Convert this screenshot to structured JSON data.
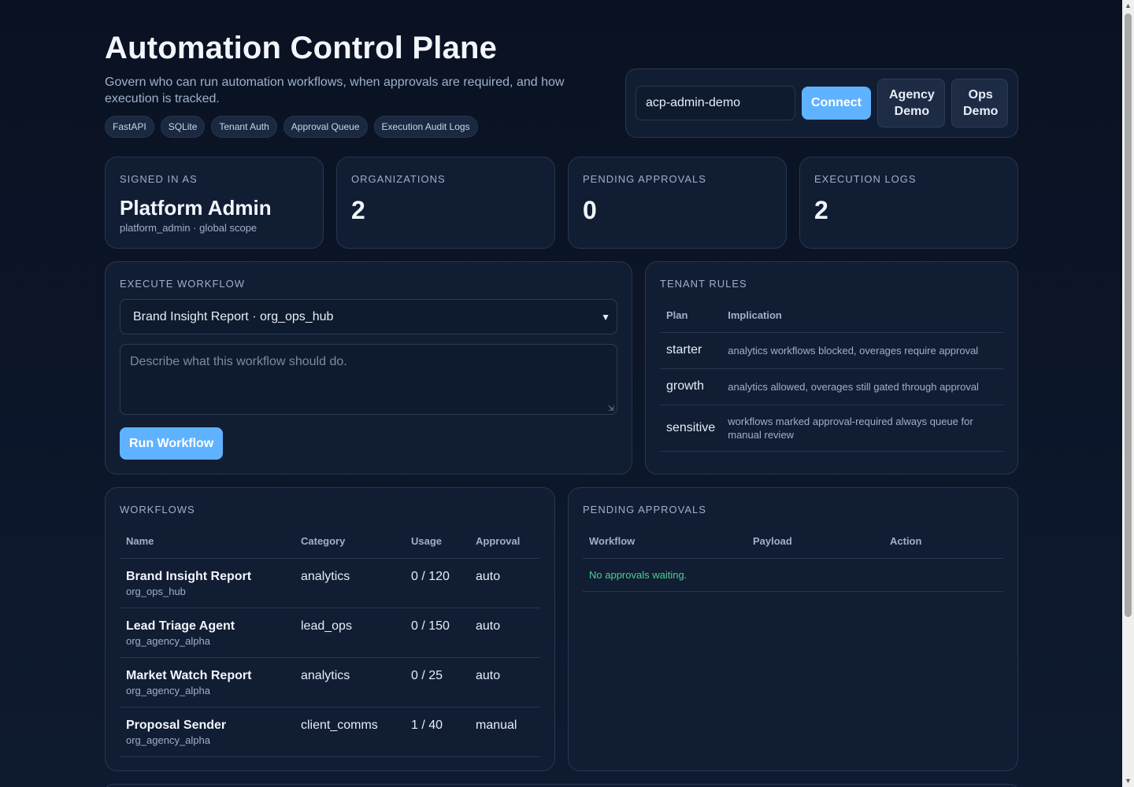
{
  "header": {
    "title": "Automation Control Plane",
    "subtitle": "Govern who can run automation workflows, when approvals are required, and how execution is tracked.",
    "tags": [
      "FastAPI",
      "SQLite",
      "Tenant Auth",
      "Approval Queue",
      "Execution Audit Logs"
    ]
  },
  "connect": {
    "token_value": "acp-admin-demo",
    "connect_label": "Connect",
    "agency_demo_label": "Agency Demo",
    "ops_demo_label": "Ops Demo"
  },
  "stats": {
    "signed_in": {
      "label": "Signed in as",
      "value": "Platform Admin",
      "sub": "platform_admin · global scope"
    },
    "organizations": {
      "label": "Organizations",
      "value": "2"
    },
    "pending": {
      "label": "Pending approvals",
      "value": "0"
    },
    "logs": {
      "label": "Execution logs",
      "value": "2"
    }
  },
  "execute": {
    "title": "Execute workflow",
    "selected_workflow": "Brand Insight Report · org_ops_hub",
    "description_placeholder": "Describe what this workflow should do.",
    "run_label": "Run Workflow"
  },
  "tenant_rules": {
    "title": "Tenant rules",
    "headers": [
      "Plan",
      "Implication"
    ],
    "rows": [
      {
        "plan": "starter",
        "implication": "analytics workflows blocked, overages require approval"
      },
      {
        "plan": "growth",
        "implication": "analytics allowed, overages still gated through approval"
      },
      {
        "plan": "sensitive",
        "implication": "workflows marked approval-required always queue for manual review"
      }
    ]
  },
  "workflows": {
    "title": "Workflows",
    "headers": [
      "Name",
      "Category",
      "Usage",
      "Approval"
    ],
    "rows": [
      {
        "name": "Brand Insight Report",
        "org": "org_ops_hub",
        "category": "analytics",
        "usage": "0 / 120",
        "approval": "auto"
      },
      {
        "name": "Lead Triage Agent",
        "org": "org_agency_alpha",
        "category": "lead_ops",
        "usage": "0 / 150",
        "approval": "auto"
      },
      {
        "name": "Market Watch Report",
        "org": "org_agency_alpha",
        "category": "analytics",
        "usage": "0 / 25",
        "approval": "auto"
      },
      {
        "name": "Proposal Sender",
        "org": "org_agency_alpha",
        "category": "client_comms",
        "usage": "1 / 40",
        "approval": "manual"
      }
    ]
  },
  "pending_approvals": {
    "title": "Pending approvals",
    "headers": [
      "Workflow",
      "Payload",
      "Action"
    ],
    "empty_text": "No approvals waiting."
  },
  "colors": {
    "background": "#0b1426",
    "card": "#111d33",
    "accent": "#5fb2ff",
    "success": "#4ccf8e"
  }
}
